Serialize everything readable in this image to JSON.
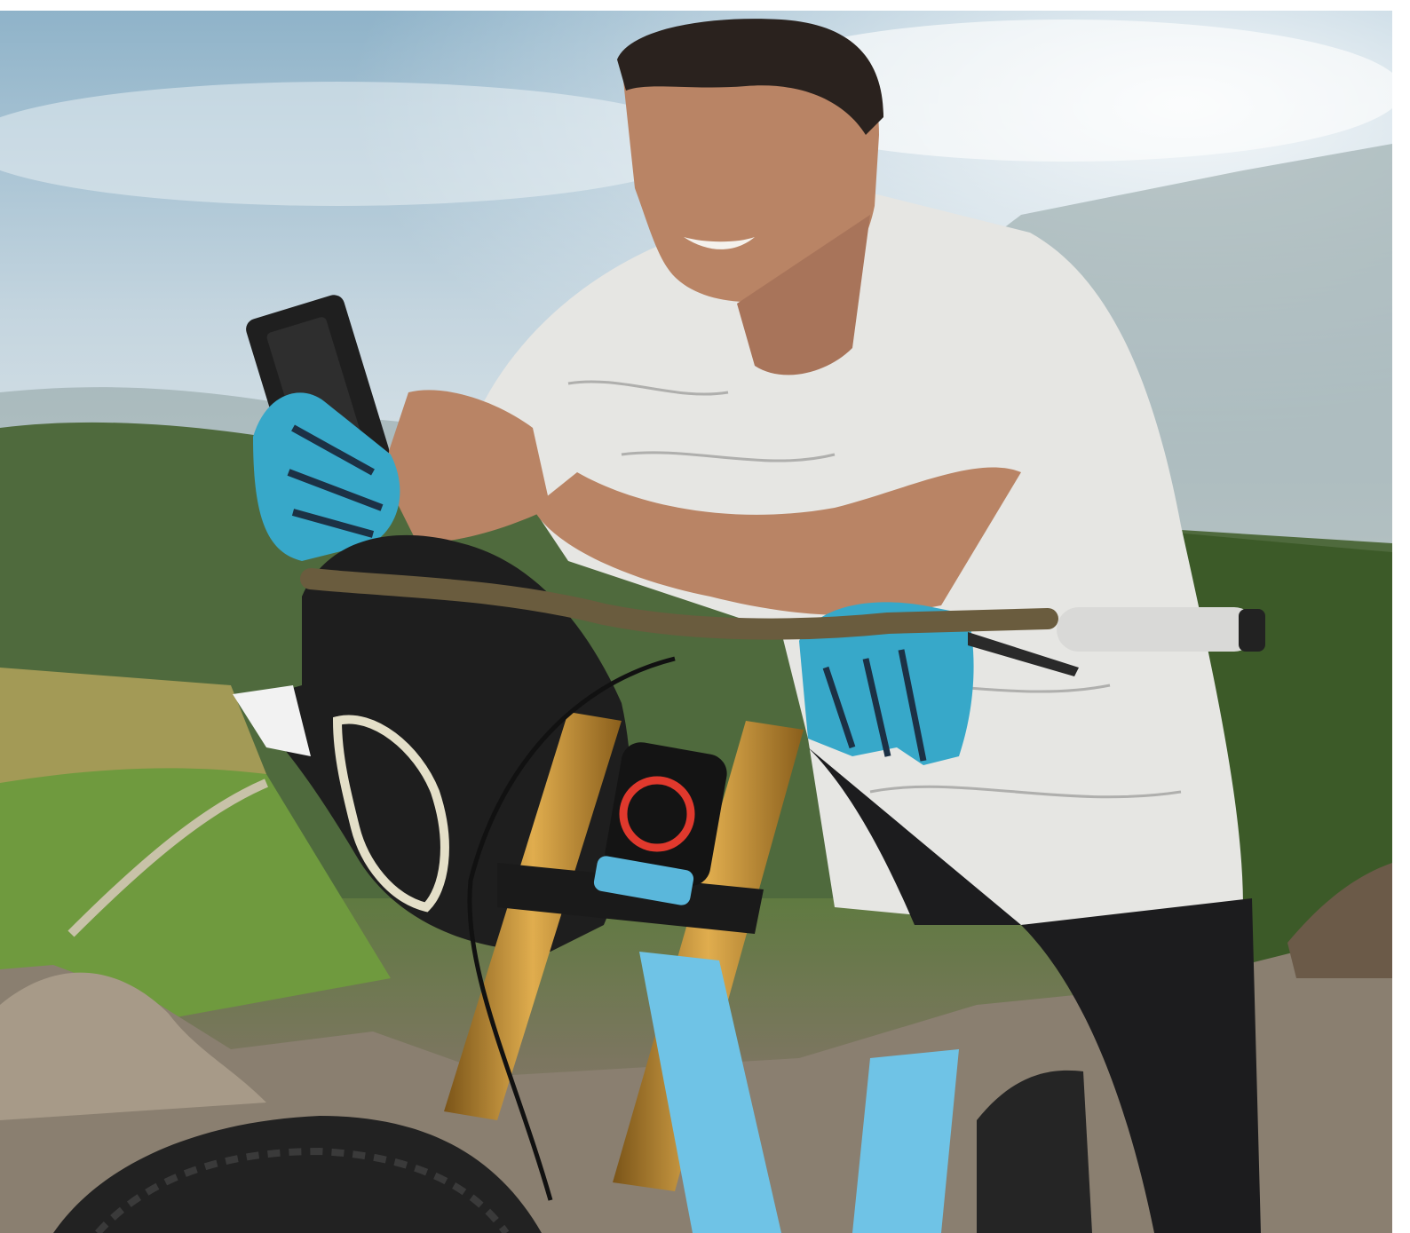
{
  "image": {
    "scene": "cyclist-with-smartphone",
    "colors": {
      "sky_top": "#8fb3c9",
      "sky_haze": "#d7e1e6",
      "hills": "#5f7556",
      "forest": "#3e5d2b",
      "field": "#6b9a3c",
      "rock": "#8a7f70",
      "shirt": "#e6e6e3",
      "skin": "#b98465",
      "glove": "#37a8c9",
      "fork_gold": "#b8842e",
      "frame_blue": "#6fc3e6",
      "tire": "#222222",
      "helmet": "#1e1e1e"
    }
  }
}
